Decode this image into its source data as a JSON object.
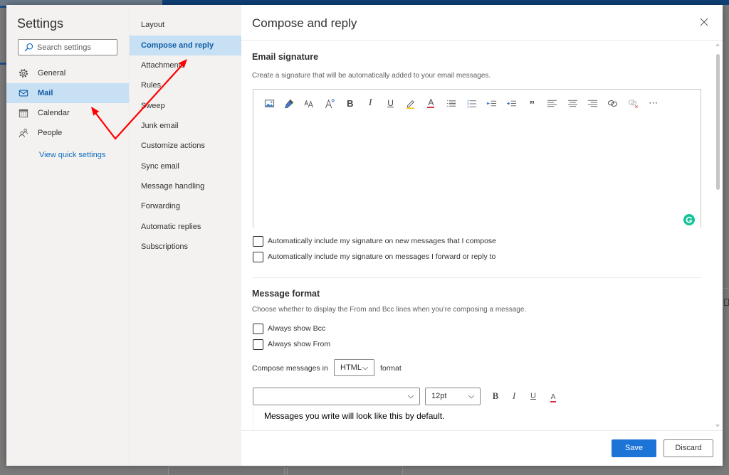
{
  "settings": {
    "title": "Settings",
    "search": {
      "placeholder": "Search settings",
      "value": ""
    },
    "nav": [
      {
        "label": "General",
        "icon": "gear-icon",
        "selected": false
      },
      {
        "label": "Mail",
        "icon": "mail-icon",
        "selected": true
      },
      {
        "label": "Calendar",
        "icon": "calendar-icon",
        "selected": false
      },
      {
        "label": "People",
        "icon": "people-icon",
        "selected": false
      }
    ],
    "quick_settings_link": "View quick settings"
  },
  "mail_subnav": {
    "items": [
      {
        "label": "Layout",
        "selected": false
      },
      {
        "label": "Compose and reply",
        "selected": true
      },
      {
        "label": "Attachments",
        "selected": false
      },
      {
        "label": "Rules",
        "selected": false
      },
      {
        "label": "Sweep",
        "selected": false
      },
      {
        "label": "Junk email",
        "selected": false
      },
      {
        "label": "Customize actions",
        "selected": false
      },
      {
        "label": "Sync email",
        "selected": false
      },
      {
        "label": "Message handling",
        "selected": false
      },
      {
        "label": "Forwarding",
        "selected": false
      },
      {
        "label": "Automatic replies",
        "selected": false
      },
      {
        "label": "Subscriptions",
        "selected": false
      }
    ]
  },
  "panel": {
    "title": "Compose and reply",
    "close_icon": "close-icon",
    "email_signature": {
      "heading": "Email signature",
      "description": "Create a signature that will be automatically added to your email messages.",
      "toolbar": [
        "image-icon",
        "format-painter-icon",
        "font-size-icon",
        "grow-font-icon",
        "bold-icon",
        "italic-icon",
        "underline-icon",
        "highlight-icon",
        "font-color-icon",
        "bullets-icon",
        "numbering-icon",
        "decrease-indent-icon",
        "increase-indent-icon",
        "quote-icon",
        "align-left-icon",
        "align-center-icon",
        "align-right-icon",
        "link-icon",
        "unlink-icon",
        "more-icon"
      ],
      "toolbar_glyphs": {
        "bold": "B",
        "italic": "I",
        "underline": "U",
        "font_color": "A",
        "quote": "”",
        "more": "⋯"
      },
      "editor_value": "",
      "extension_icon": "grammarly-icon",
      "options": [
        {
          "label": "Automatically include my signature on new messages that I compose",
          "checked": false
        },
        {
          "label": "Automatically include my signature on messages I forward or reply to",
          "checked": false
        }
      ]
    },
    "message_format": {
      "heading": "Message format",
      "description": "Choose whether to display the From and Bcc lines when you’re composing a message.",
      "options": [
        {
          "label": "Always show Bcc",
          "checked": false
        },
        {
          "label": "Always show From",
          "checked": false
        }
      ],
      "compose_prefix": "Compose messages in",
      "compose_format": "HTML",
      "compose_suffix": "format",
      "font_family": "",
      "font_size": "12pt",
      "format_buttons": {
        "bold": "B",
        "italic": "I",
        "underline": "U",
        "font_color": "A"
      },
      "preview_text": "Messages you write will look like this by default."
    },
    "footer": {
      "save_label": "Save",
      "discard_label": "Discard"
    }
  },
  "colors": {
    "accent": "#0f6cbd",
    "selected_bg": "#c7e0f4",
    "selected_text": "#115ea3",
    "save_button": "#1b74d6",
    "grammarly": "#15c39a",
    "annotation_arrow": "#ff0000",
    "app_header": "#0f4177"
  }
}
